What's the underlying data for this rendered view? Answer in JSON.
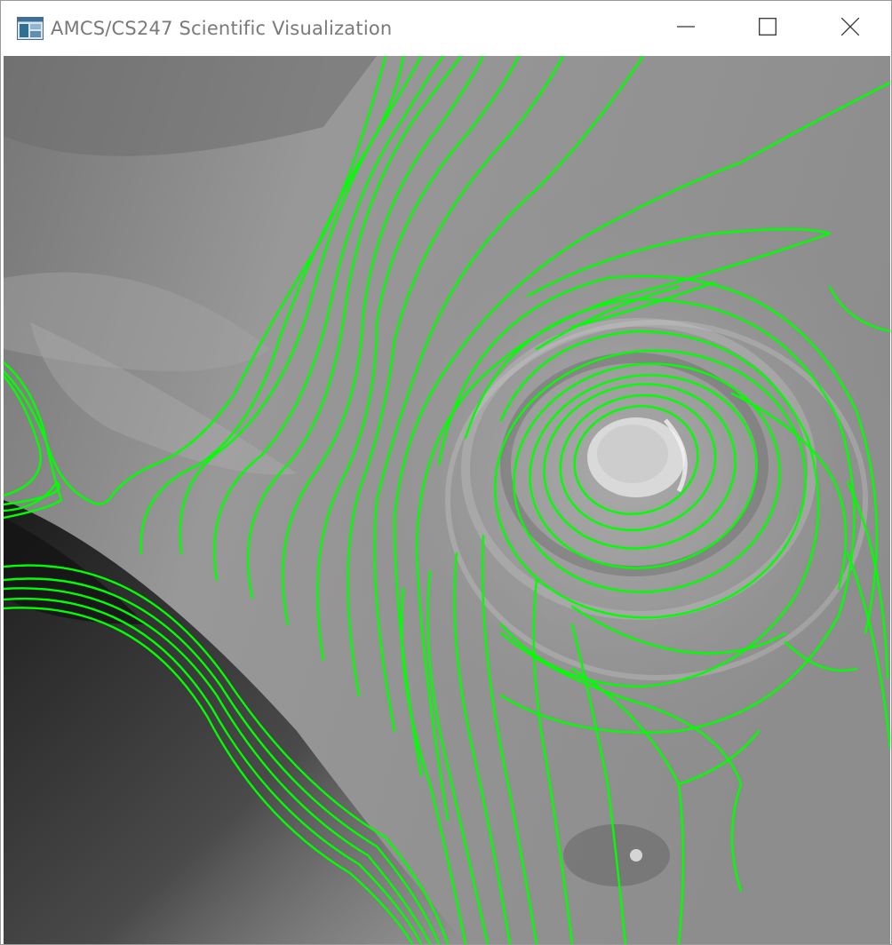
{
  "window": {
    "title": "AMCS/CS247 Scientific Visualization",
    "icon": "app-window-icon",
    "controls": {
      "minimize": "minimize-icon",
      "maximize": "maximize-icon",
      "close": "close-icon"
    }
  },
  "visualization": {
    "type": "streamlines-over-grayscale-flow-field",
    "streamline_color": "#00ff00",
    "background": "grayscale scalar field"
  }
}
